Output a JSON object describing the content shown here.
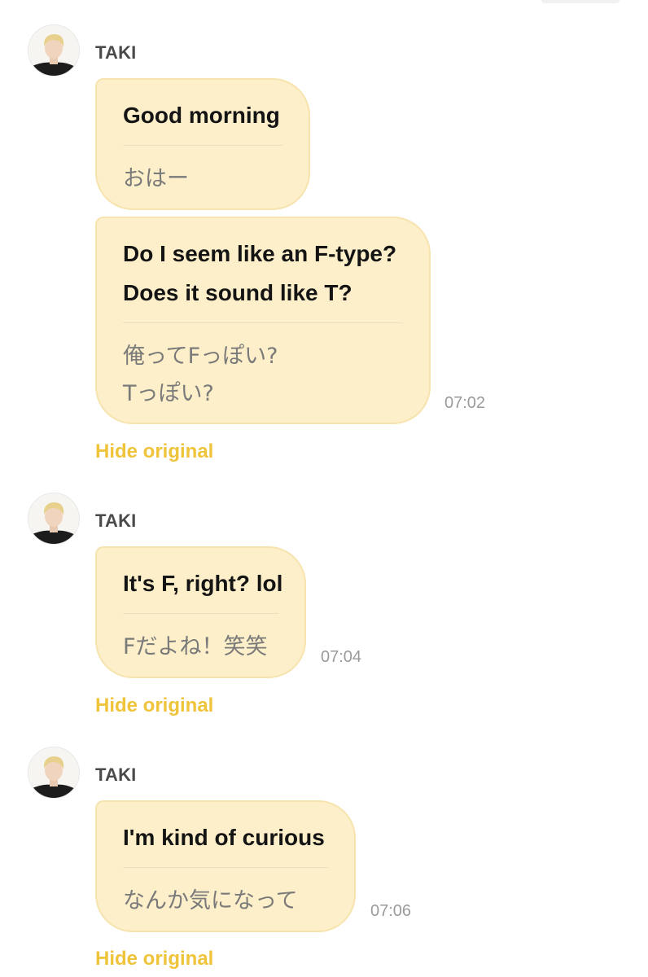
{
  "sender_name": "TAKI",
  "hide_original_label": "Hide original",
  "messages": [
    {
      "translated": [
        "Good morning"
      ],
      "original": [
        "おはー"
      ],
      "time": ""
    },
    {
      "translated": [
        "Do I seem like an F-type?",
        "Does it sound like T?"
      ],
      "original": [
        "俺ってFっぽい?",
        "Tっぽい?"
      ],
      "time": "07:02"
    },
    {
      "translated": [
        "It's F, right? lol"
      ],
      "original": [
        "Fだよね！笑笑"
      ],
      "time": "07:04"
    },
    {
      "translated": [
        "I'm kind of curious"
      ],
      "original": [
        "なんか気になって"
      ],
      "time": "07:06"
    }
  ],
  "colors": {
    "bubble_bg": "#fdefc9",
    "bubble_border": "#f7e3ae",
    "hide_link": "#efc43a",
    "timestamp": "#9a9a9a"
  }
}
